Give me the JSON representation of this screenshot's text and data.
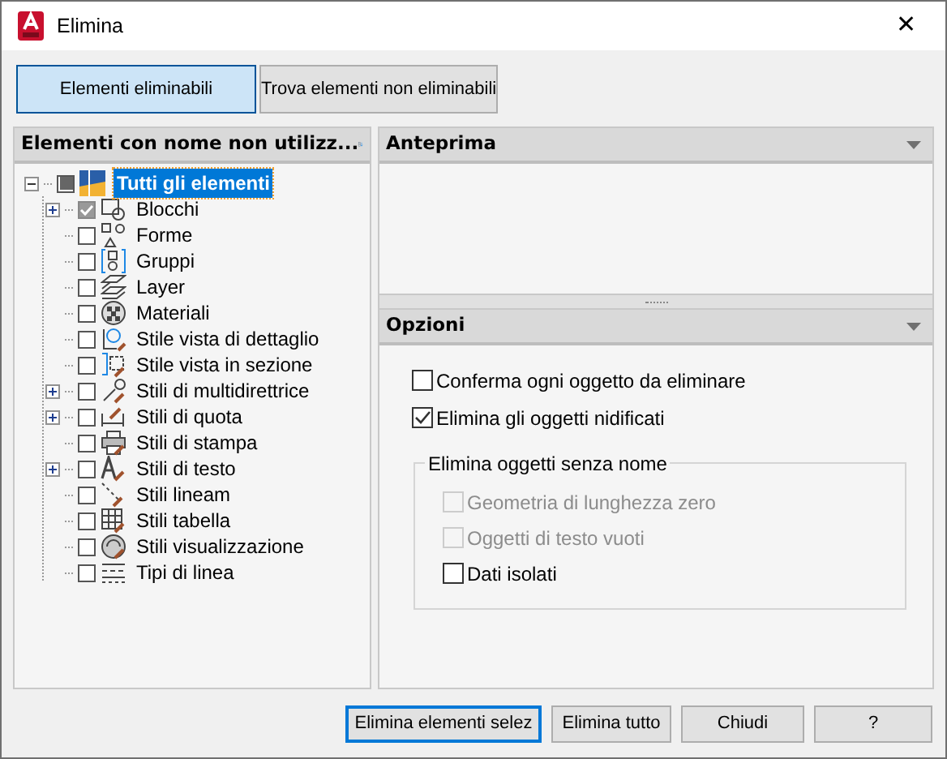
{
  "window": {
    "title": "Elimina",
    "close": "✕"
  },
  "view_buttons": [
    {
      "label": "Elementi eliminabili",
      "selected": true
    },
    {
      "label": "Trova elementi non eliminabili",
      "selected": false
    }
  ],
  "tree": {
    "header": "Elementi con nome non utilizz...",
    "root": {
      "label": "Tutti gli elementi",
      "partial": true,
      "expanded": true,
      "selected": true,
      "children": [
        {
          "label": "Blocchi",
          "checked": true,
          "collapsed": true
        },
        {
          "label": "Forme",
          "checked": false,
          "collapsed": false
        },
        {
          "label": "Gruppi",
          "checked": false,
          "collapsed": false
        },
        {
          "label": "Layer",
          "checked": false,
          "collapsed": false
        },
        {
          "label": "Materiali",
          "checked": false,
          "collapsed": false
        },
        {
          "label": "Stile vista di dettaglio",
          "checked": false,
          "collapsed": false
        },
        {
          "label": "Stile vista in sezione",
          "checked": false,
          "collapsed": false
        },
        {
          "label": "Stili di multidirettrice",
          "checked": false,
          "collapsed": true
        },
        {
          "label": "Stili di quota",
          "checked": false,
          "collapsed": true
        },
        {
          "label": "Stili di stampa",
          "checked": false,
          "collapsed": false
        },
        {
          "label": "Stili di testo",
          "checked": false,
          "collapsed": true
        },
        {
          "label": "Stili lineam",
          "checked": false,
          "collapsed": false
        },
        {
          "label": "Stili tabella",
          "checked": false,
          "collapsed": false
        },
        {
          "label": "Stili visualizzazione",
          "checked": false,
          "collapsed": false
        },
        {
          "label": "Tipi di linea",
          "checked": false,
          "collapsed": false
        }
      ]
    }
  },
  "preview": {
    "title": "Anteprima"
  },
  "options": {
    "title": "Opzioni",
    "checkboxes": [
      {
        "label": "Conferma ogni oggetto da eliminare",
        "checked": false,
        "disabled": false
      },
      {
        "label": "Elimina gli oggetti nidificati",
        "checked": true,
        "disabled": false
      }
    ],
    "group": {
      "title": "Elimina oggetti senza nome",
      "checkboxes": [
        {
          "label": "Geometria di lunghezza zero",
          "checked": false,
          "disabled": true
        },
        {
          "label": "Oggetti di testo vuoti",
          "checked": false,
          "disabled": true
        },
        {
          "label": "Dati isolati",
          "checked": false,
          "disabled": false
        }
      ]
    }
  },
  "buttons": [
    {
      "label": "Elimina elementi selez",
      "default": true
    },
    {
      "label": "Elimina tutto",
      "default": false
    },
    {
      "label": "Chiudi",
      "default": false
    },
    {
      "label": "?",
      "default": false
    }
  ]
}
